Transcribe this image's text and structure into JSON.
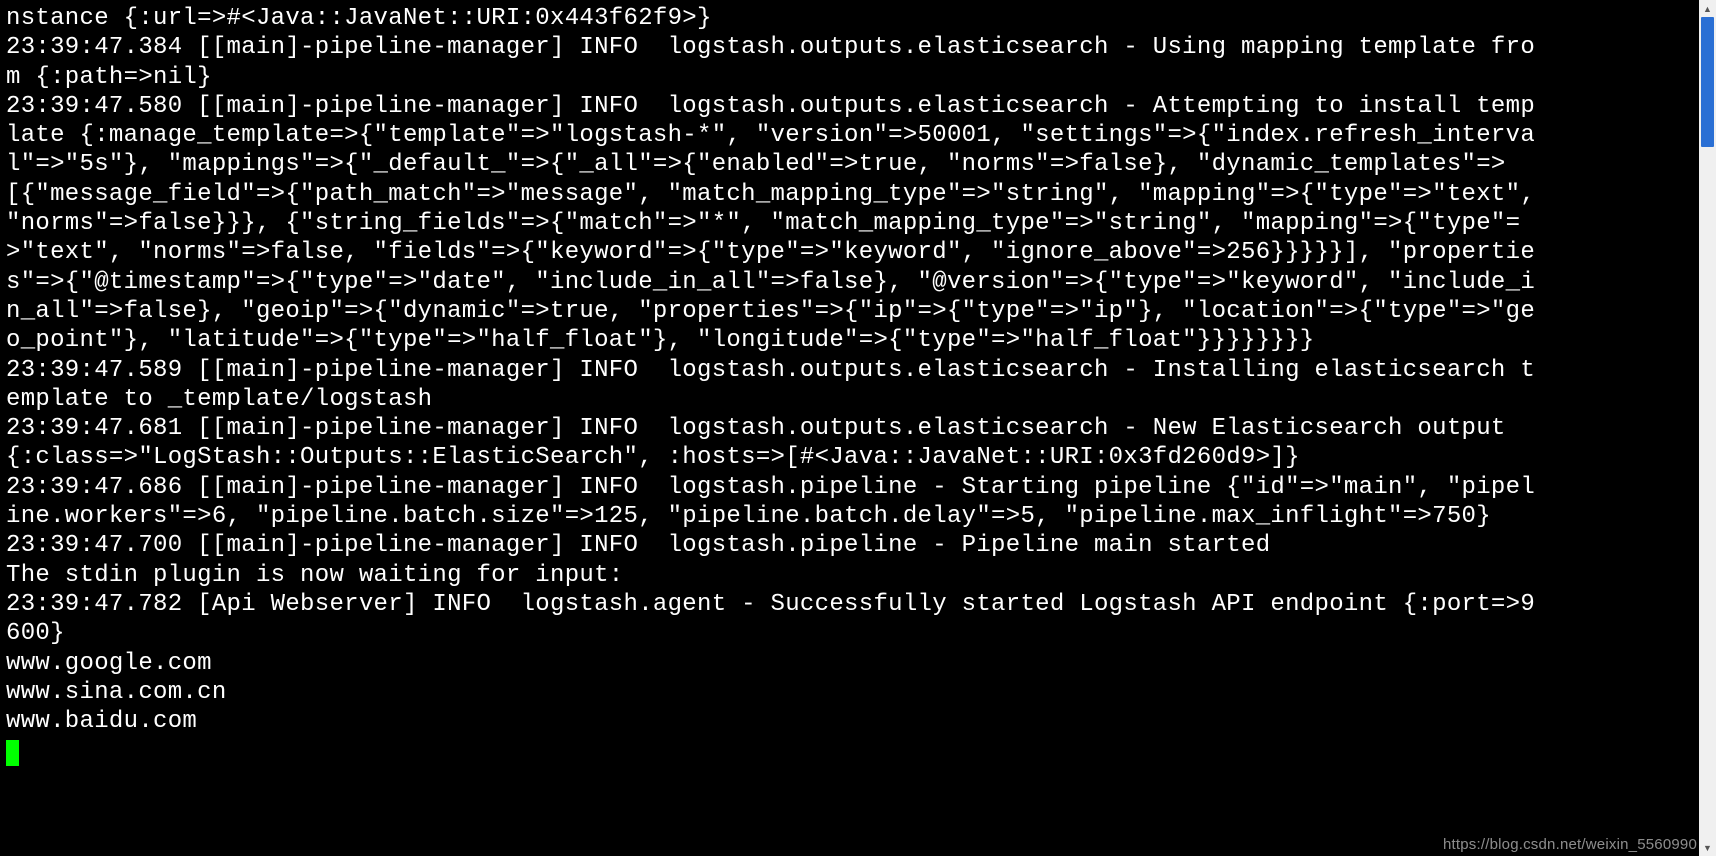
{
  "terminal": {
    "lines": [
      "nstance {:url=>#<Java::JavaNet::URI:0x443f62f9>}",
      "23:39:47.384 [[main]-pipeline-manager] INFO  logstash.outputs.elasticsearch - Using mapping template from {:path=>nil}",
      "23:39:47.580 [[main]-pipeline-manager] INFO  logstash.outputs.elasticsearch - Attempting to install template {:manage_template=>{\"template\"=>\"logstash-*\", \"version\"=>50001, \"settings\"=>{\"index.refresh_interval\"=>\"5s\"}, \"mappings\"=>{\"_default_\"=>{\"_all\"=>{\"enabled\"=>true, \"norms\"=>false}, \"dynamic_templates\"=>[{\"message_field\"=>{\"path_match\"=>\"message\", \"match_mapping_type\"=>\"string\", \"mapping\"=>{\"type\"=>\"text\", \"norms\"=>false}}}, {\"string_fields\"=>{\"match\"=>\"*\", \"match_mapping_type\"=>\"string\", \"mapping\"=>{\"type\"=>\"text\", \"norms\"=>false, \"fields\"=>{\"keyword\"=>{\"type\"=>\"keyword\", \"ignore_above\"=>256}}}}}], \"properties\"=>{\"@timestamp\"=>{\"type\"=>\"date\", \"include_in_all\"=>false}, \"@version\"=>{\"type\"=>\"keyword\", \"include_in_all\"=>false}, \"geoip\"=>{\"dynamic\"=>true, \"properties\"=>{\"ip\"=>{\"type\"=>\"ip\"}, \"location\"=>{\"type\"=>\"geo_point\"}, \"latitude\"=>{\"type\"=>\"half_float\"}, \"longitude\"=>{\"type\"=>\"half_float\"}}}}}}}}",
      "23:39:47.589 [[main]-pipeline-manager] INFO  logstash.outputs.elasticsearch - Installing elasticsearch template to _template/logstash",
      "23:39:47.681 [[main]-pipeline-manager] INFO  logstash.outputs.elasticsearch - New Elasticsearch output {:class=>\"LogStash::Outputs::ElasticSearch\", :hosts=>[#<Java::JavaNet::URI:0x3fd260d9>]}",
      "23:39:47.686 [[main]-pipeline-manager] INFO  logstash.pipeline - Starting pipeline {\"id\"=>\"main\", \"pipeline.workers\"=>6, \"pipeline.batch.size\"=>125, \"pipeline.batch.delay\"=>5, \"pipeline.max_inflight\"=>750}",
      "23:39:47.700 [[main]-pipeline-manager] INFO  logstash.pipeline - Pipeline main started",
      "The stdin plugin is now waiting for input:",
      "23:39:47.782 [Api Webserver] INFO  logstash.agent - Successfully started Logstash API endpoint {:port=>9600}",
      "www.google.com",
      "www.sina.com.cn",
      "www.baidu.com"
    ]
  },
  "scrollbar": {
    "arrow_up": "▲",
    "arrow_down": "▼"
  },
  "watermark": "https://blog.csdn.net/weixin_5560990"
}
